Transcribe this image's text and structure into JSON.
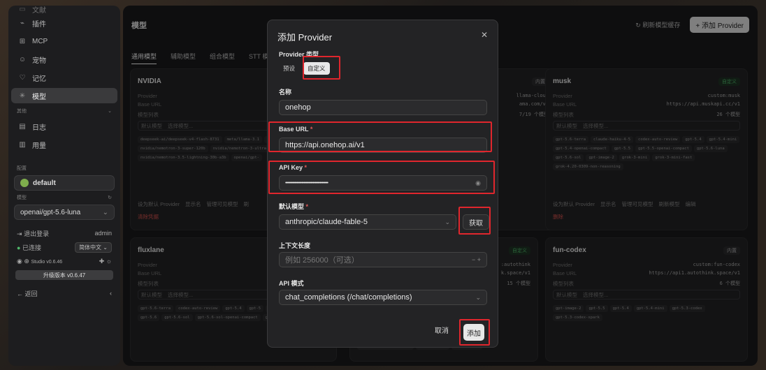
{
  "sidebar": {
    "top_partial": "文献",
    "items": [
      {
        "icon": "plug-icon",
        "glyph": "⌁",
        "label": "插件"
      },
      {
        "icon": "mcp-icon",
        "glyph": "⊞",
        "label": "MCP"
      },
      {
        "icon": "pet-icon",
        "glyph": "☺",
        "label": "宠物"
      },
      {
        "icon": "memory-icon",
        "glyph": "♡",
        "label": "记忆"
      },
      {
        "icon": "model-icon",
        "glyph": "✳",
        "label": "模型"
      }
    ],
    "section_other": "其他",
    "items2": [
      {
        "icon": "log-icon",
        "glyph": "▤",
        "label": "日志"
      },
      {
        "icon": "usage-icon",
        "glyph": "▥",
        "label": "用量"
      }
    ],
    "section_config": "配置",
    "profile": "default",
    "section_model": "模型",
    "model_select": "openai/gpt-5.6-luna",
    "logout": "退出登录",
    "user": "admin",
    "connected": "已连接",
    "lang": "简体中文",
    "studio": "Studio v0.6.46",
    "upgrade": "升级版本 v0.6.47",
    "back": "返回"
  },
  "main": {
    "title": "模型",
    "refresh": "刷新模型缓存",
    "add_provider": "+ 添加 Provider",
    "tabs": [
      "通用模型",
      "辅助模型",
      "组合模型",
      "STT 模"
    ],
    "cards": [
      {
        "name": "NVIDIA",
        "badge": "",
        "provider": "Provider",
        "provider_val": "",
        "base_url_label": "Base URL",
        "base_url": "https://integrat",
        "model_list": "模型列表",
        "count": "",
        "default_label": "默认模型",
        "default_ph": "选择模型...",
        "tags": [
          "deepseek-ai/deepseek-v4-flash-8731",
          "meta/llama-3.1",
          "minimaxai/minimax-m3",
          "nvidia/nemotron-3-super-120b",
          "nvidia/nemotron-3-ultra-550b-a55b",
          "nvidia/nemotron-3.5-lightning-30b-a3b",
          "openai/gpt-"
        ],
        "actions": [
          "设为默认 Provider",
          "显示名",
          "管理可见模型",
          "刷"
        ],
        "delete": "清除凭据"
      },
      {
        "name": "",
        "badge": "内置",
        "provider": "",
        "provider_val": "llama-cloud",
        "base_url_label": "",
        "base_url": "ama.com/v1",
        "model_list": "",
        "count": "7/19 个模型",
        "default_label": "",
        "default_ph": "",
        "tags": [],
        "actions": [
          "编辑"
        ],
        "delete": ""
      },
      {
        "name": "musk",
        "badge": "自定义",
        "provider": "Provider",
        "provider_val": "custom:musk",
        "base_url_label": "Base URL",
        "base_url": "https://api.muskapi.cc/v1",
        "model_list": "模型列表",
        "count": "26 个模型",
        "default_label": "默认模型",
        "default_ph": "选择模型...",
        "tags": [
          "gpt-5.6-terra",
          "claude-haiku-4-5",
          "codex-auto-review",
          "gpt-5.4",
          "gpt-5.4-mini",
          "gpt-5.4-openai-compact",
          "gpt-5.5",
          "gpt-5.5-openai-compact",
          "gpt-5.6-luna",
          "gpt-5.6-sol",
          "gpt-image-2",
          "grok-3-mini",
          "grok-3-mini-fast",
          "grok-4.20-0309-non-reasoning"
        ],
        "actions": [
          "设为默认 Provider",
          "显示名",
          "管理可见模型",
          "刷新模型",
          "编辑"
        ],
        "delete": "删除"
      },
      {
        "name": "fluxlane",
        "badge": "",
        "provider": "Provider",
        "provider_val": "",
        "base_url_label": "Base URL",
        "base_url": "https:/",
        "model_list": "模型列表",
        "count": "",
        "default_label": "默认模型",
        "default_ph": "选择模型...",
        "tags": [
          "gpt-5.6-terra",
          "codex-auto-review",
          "gpt-5.4",
          "gpt-5",
          "gpt-5.5-openai-compact",
          "gpt-5.6",
          "gpt-5.6-sol",
          "gpt-5.6-sol-openai-compact",
          "gpt-5.6-terra-openai-c"
        ],
        "actions": [],
        "delete": ""
      },
      {
        "name": "",
        "badge": "自定义",
        "provider": "",
        "provider_val": ":autothink",
        "base_url_label": "",
        "base_url": "k.space/v1",
        "model_list": "",
        "count": "15 个模型",
        "default_label": "",
        "default_ph": "",
        "tags": [
          "gpt-5.5-openai-compact",
          "gpt-5.6-luna",
          "gpt-5.6-sol"
        ],
        "actions": [],
        "delete": ""
      },
      {
        "name": "fun-codex",
        "badge": "内置",
        "provider": "Provider",
        "provider_val": "custom:fun-codex",
        "base_url_label": "Base URL",
        "base_url": "https://api1.autothink.space/v1",
        "model_list": "模型列表",
        "count": "6 个模型",
        "default_label": "默认模型",
        "default_ph": "选择模型...",
        "tags": [
          "gpt-image-2",
          "gpt-5.5",
          "gpt-5.4",
          "gpt-5.4-mini",
          "gpt-5.3-codex",
          "gpt-5.3-codex-spark"
        ],
        "actions": [],
        "delete": ""
      }
    ]
  },
  "dialog": {
    "title": "添加 Provider",
    "type_label": "Provider 类型",
    "type_preset": "预设",
    "type_custom": "自定义",
    "name_label": "名称",
    "name_value": "onehop",
    "base_url_label": "Base URL",
    "base_url_value": "https://api.onehop.ai/v1",
    "api_key_label": "API Key",
    "api_key_value": "••••••••••••••••••••••••••••••••••••••••••",
    "default_model_label": "默认模型",
    "default_model_value": "anthropic/claude-fable-5",
    "fetch": "获取",
    "context_label": "上下文长度",
    "context_placeholder": "例如 256000（可选）",
    "api_mode_label": "API 模式",
    "api_mode_value": "chat_completions (/chat/completions)",
    "cancel": "取消",
    "add": "添加",
    "required_mark": "*"
  },
  "colors": {
    "highlight": "#e0262d",
    "accent_green": "#4fb86a",
    "danger": "#d9534f"
  }
}
